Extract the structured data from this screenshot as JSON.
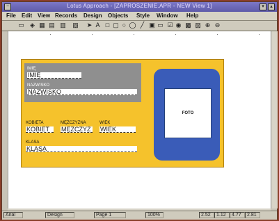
{
  "window": {
    "title": "Lotus Approach - [ZAPROSZENIE.APR - NEW View 1]"
  },
  "menu": [
    "File",
    "Edit",
    "View",
    "Records",
    "Design",
    "Objects",
    "Style",
    "Window",
    "Help"
  ],
  "toolbar": {
    "icons": [
      "pointer-icon",
      "text-icon",
      "field-icon",
      "rectangle-icon",
      "rounded-rect-icon",
      "ellipse-icon",
      "line-icon",
      "button-icon",
      "checkbox-icon",
      "radio-icon",
      "picture-icon",
      "zoom-in-icon",
      "zoom-out-icon"
    ]
  },
  "form": {
    "imie_label": "IMIĘ",
    "imie_value": "IMIĘ",
    "nazwisko_label": "NAZWISKO",
    "nazwisko_value": "NAZWISKO",
    "kobieta_label": "KOBIETA",
    "kobieta_value": "KOBIET",
    "mezczyzna_label": "MĘŻCZYZNA",
    "mezczyzna_value": "MĘŻCZYZ",
    "wiek_label": "WIEK",
    "wiek_value": "WIEK",
    "klasa_label": "KLASA",
    "klasa_value": "KLASA",
    "photo_label": "FOTO"
  },
  "status": {
    "font": "Arial",
    "style": "Design",
    "page": "Page 1",
    "zoom": "100%",
    "x": "2.52",
    "y": "1.12",
    "w": "4.77",
    "h": "2.81"
  },
  "colors": {
    "form_background": "#f5c22c",
    "card_blue": "#3a5cb8",
    "titlebar": "#5e5aa8"
  }
}
